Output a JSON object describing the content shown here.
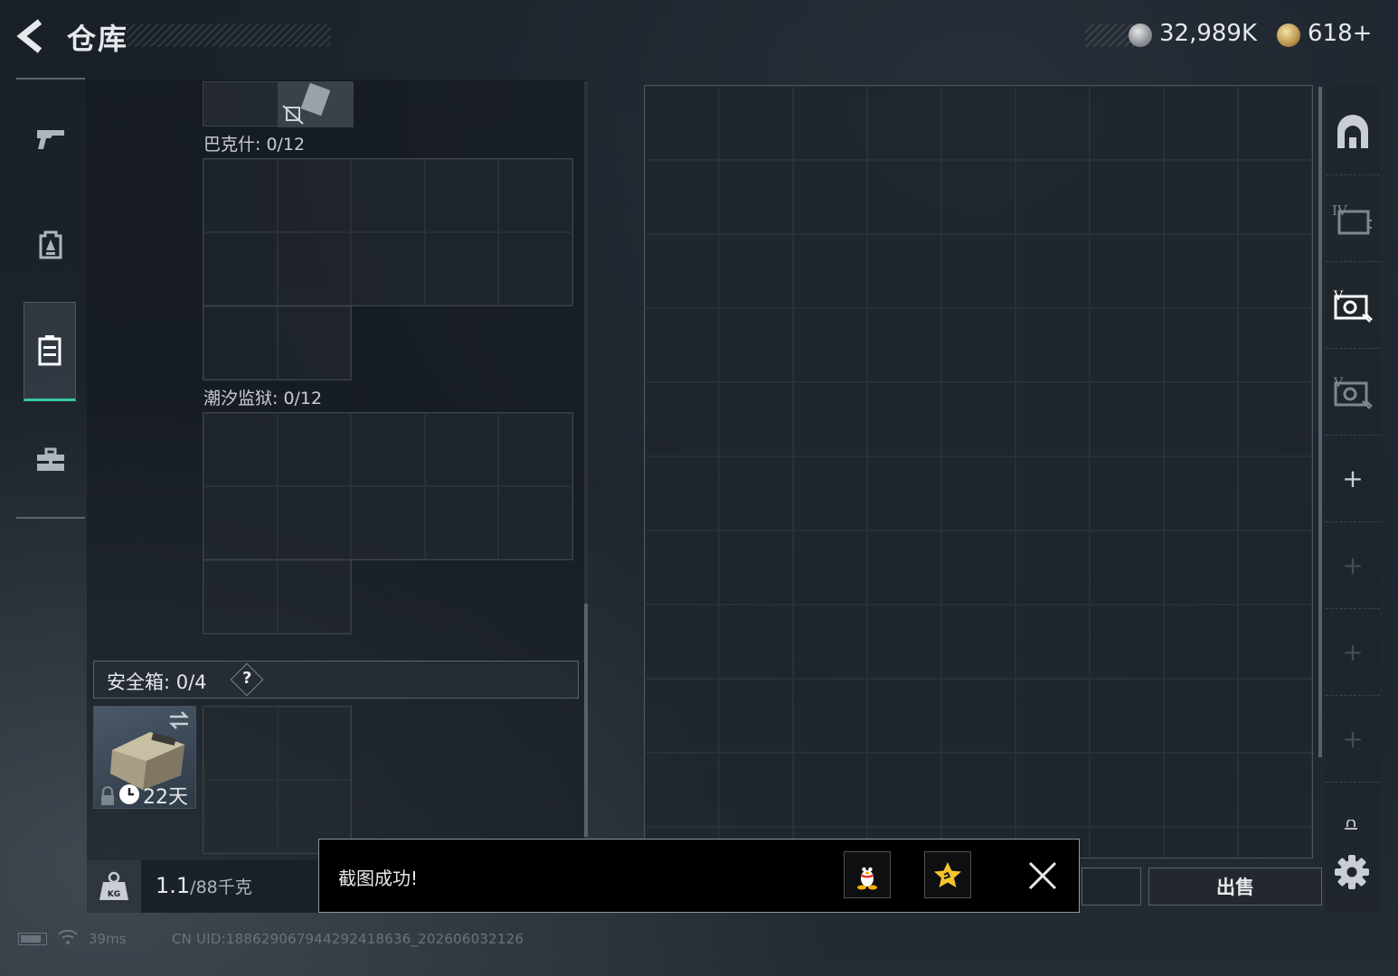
{
  "header": {
    "title": "仓库",
    "back_icon": "chevron-left-icon",
    "currencies": [
      {
        "icon": "silver-coin-icon",
        "amount": "32,989K",
        "color": "#b8bcc1"
      },
      {
        "icon": "gold-coin-icon",
        "amount": "618+",
        "color": "#c9a55a"
      }
    ]
  },
  "categories": [
    {
      "icon": "pistol-icon",
      "active": false
    },
    {
      "icon": "backpack-icon",
      "active": false
    },
    {
      "icon": "storage-locker-icon",
      "active": true
    },
    {
      "icon": "toolbox-icon",
      "active": false
    }
  ],
  "containers": [
    {
      "label": "巴克什: 0/12"
    },
    {
      "label": "潮汐监狱: 0/12"
    }
  ],
  "safe_box": {
    "label": "安全箱:  0/4",
    "help": "?",
    "duration": "22天"
  },
  "weight": {
    "value": "1.1",
    "capacity": "/88千克"
  },
  "right_tabs": [
    {
      "icon": "gate-arch-icon"
    },
    {
      "icon": "roman-iv-storage-icon"
    },
    {
      "icon": "storage-expand-icon",
      "active": true
    },
    {
      "icon": "storage-expand-icon"
    },
    {
      "label": "+"
    },
    {
      "label": "+"
    },
    {
      "label": "+"
    },
    {
      "label": "+"
    }
  ],
  "actions": {
    "sell": "出售"
  },
  "toast": {
    "message": "截图成功!",
    "share_qq_icon": "qq-penguin-icon",
    "share_favorite_icon": "star-favorite-icon"
  },
  "status": {
    "ping": "39ms",
    "uid": "CN UID:18862906794429​2418636_202606032126"
  },
  "colors": {
    "accent": "#38c9a8",
    "background": "#1c232b",
    "toast_bg": "#000000"
  }
}
